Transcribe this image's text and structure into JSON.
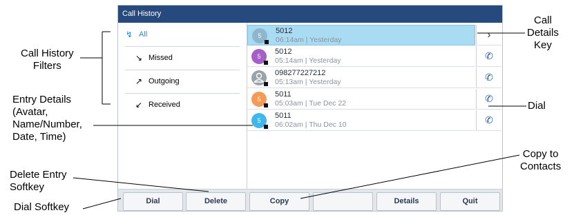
{
  "screen": {
    "title": "Call History",
    "filters": [
      {
        "label": "All",
        "icon": "all-calls-icon",
        "glyph": "↯",
        "active": true
      },
      {
        "label": "Missed",
        "icon": "missed-call-icon",
        "glyph": "↘",
        "active": false
      },
      {
        "label": "Outgoing",
        "icon": "outgoing-call-icon",
        "glyph": "↗",
        "active": false
      },
      {
        "label": "Received",
        "icon": "received-call-icon",
        "glyph": "↙",
        "active": false
      }
    ],
    "entries": [
      {
        "avatar": "5",
        "avatar_color": "#8eb6cc",
        "name": "5012",
        "meta": "06:14am | Yesterday",
        "action": "chevron",
        "action_glyph": "›",
        "selected": true
      },
      {
        "avatar": "5",
        "avatar_color": "#a55fc6",
        "name": "5012",
        "meta": "05:14am | Yesterday",
        "action": "dial",
        "action_glyph": "✆",
        "selected": false
      },
      {
        "avatar": "",
        "avatar_color": "#9aa3ac",
        "name": "098277227212",
        "meta": "05:13am | Yesterday",
        "action": "dial",
        "action_glyph": "✆",
        "selected": false
      },
      {
        "avatar": "5",
        "avatar_color": "#f59a57",
        "name": "5011",
        "meta": "05:03am | Tue Dec 22",
        "action": "dial",
        "action_glyph": "✆",
        "selected": false
      },
      {
        "avatar": "5",
        "avatar_color": "#3fb6ec",
        "name": "5011",
        "meta": "06:02am | Thu Dec 10",
        "action": "dial",
        "action_glyph": "✆",
        "selected": false
      }
    ],
    "softkeys": [
      "Dial",
      "Delete",
      "Copy",
      "",
      "Details",
      "Quit"
    ]
  },
  "callouts": {
    "filters": "Call History\nFilters",
    "entry_details": "Entry Details\n(Avatar,\nName/Number,\nDate, Time)",
    "delete_softkey": "Delete Entry\nSoftkey",
    "dial_softkey": "Dial Softkey",
    "details_key": "Call\nDetails\nKey",
    "dial": "Dial",
    "copy_contacts": "Copy to\nContacts"
  },
  "colors": {
    "title_bar": "#26497e",
    "selected_row": "#a9dcf3",
    "active_filter": "#1a8cd8"
  }
}
